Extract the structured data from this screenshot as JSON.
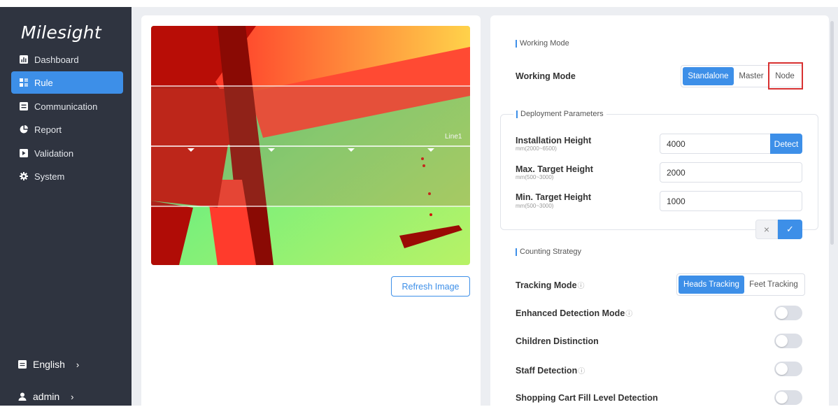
{
  "brand": {
    "logo_text": "Milesight"
  },
  "sidebar": {
    "items": [
      {
        "label": "Dashboard",
        "icon": "dashboard-icon",
        "active": false
      },
      {
        "label": "Rule",
        "icon": "rule-icon",
        "active": true
      },
      {
        "label": "Communication",
        "icon": "communication-icon",
        "active": false
      },
      {
        "label": "Report",
        "icon": "report-icon",
        "active": false
      },
      {
        "label": "Validation",
        "icon": "validation-icon",
        "active": false
      },
      {
        "label": "System",
        "icon": "gear-icon",
        "active": false
      }
    ],
    "language": {
      "label": "English",
      "icon": "language-icon"
    },
    "user": {
      "label": "admin",
      "icon": "user-icon"
    }
  },
  "image_panel": {
    "line_label": "Line1",
    "refresh_label": "Refresh Image"
  },
  "working_mode": {
    "section_title": "Working Mode",
    "label": "Working Mode",
    "options": [
      "Standalone",
      "Master",
      "Node"
    ],
    "selected": "Standalone"
  },
  "deployment": {
    "section_title": "Deployment Parameters",
    "installation_height": {
      "label": "Installation Height",
      "range": "mm(2000~6500)",
      "value": "4000",
      "detect_label": "Detect"
    },
    "max_target_height": {
      "label": "Max. Target Height",
      "range": "mm(500~3000)",
      "value": "2000"
    },
    "min_target_height": {
      "label": "Min. Target Height",
      "range": "mm(500~3000)",
      "value": "1000"
    },
    "cancel_symbol": "×",
    "confirm_symbol": "✓"
  },
  "counting": {
    "section_title": "Counting Strategy",
    "tracking_mode": {
      "label": "Tracking Mode",
      "options": [
        "Heads Tracking",
        "Feet Tracking"
      ],
      "selected": "Heads Tracking"
    },
    "enhanced_detection": {
      "label": "Enhanced Detection Mode",
      "enabled": false
    },
    "children_distinction": {
      "label": "Children Distinction",
      "enabled": false
    },
    "staff_detection": {
      "label": "Staff Detection",
      "enabled": false
    },
    "shopping_cart": {
      "label": "Shopping Cart Fill Level Detection",
      "enabled": false
    }
  },
  "info_symbol": "ⓘ",
  "chevron": "›",
  "colors": {
    "accent": "#3d8fe8",
    "sidebar_bg": "#2f3440",
    "highlight": "#d83131"
  }
}
